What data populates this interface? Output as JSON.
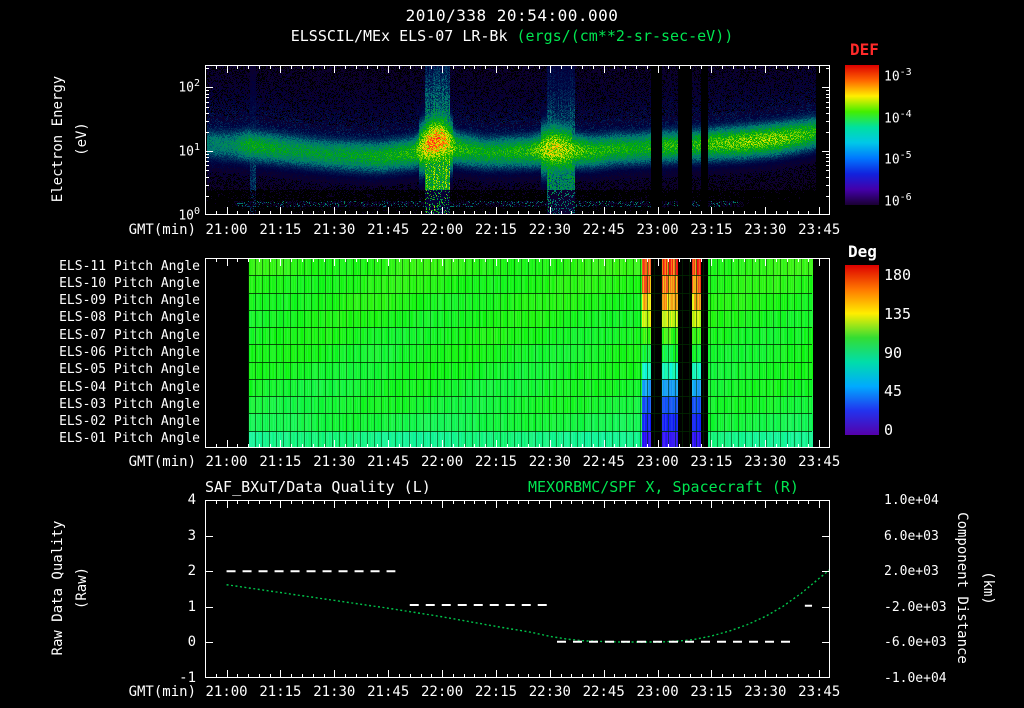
{
  "header": {
    "timestamp": "2010/338 20:54:00.000",
    "instrument": "ELSSCIL/MEx ELS-07 LR-Bk",
    "units": "(ergs/(cm**2-sr-sec-eV))"
  },
  "colors": {
    "background": "#000000",
    "frame": "#ffffff",
    "text": "#ffffff",
    "green_text": "#00e550",
    "def_label": "#ff2a2a",
    "curve_green": "#00c24a",
    "quality_white": "#ffffff",
    "def_colorbar_stops": [
      "#dd0000",
      "#ff6600",
      "#ffee00",
      "#44ee00",
      "#00e0a0",
      "#00c8e8",
      "#0077ff",
      "#1122dd",
      "#4400aa",
      "#1a0033"
    ],
    "deg_colorbar_stops": [
      "#dd0000",
      "#ff7700",
      "#ffee00",
      "#33dd33",
      "#00ddaa",
      "#00aaff",
      "#2233ee",
      "#5500aa"
    ]
  },
  "time_axis": {
    "label": "GMT(min)",
    "start": "20:54",
    "end": "23:48",
    "total_minutes": 174,
    "major_ticks": [
      "21:00",
      "21:15",
      "21:30",
      "21:45",
      "22:00",
      "22:15",
      "22:30",
      "22:45",
      "23:00",
      "23:15",
      "23:30",
      "23:45"
    ],
    "major_tick_minutes": [
      6,
      21,
      36,
      51,
      66,
      81,
      96,
      111,
      126,
      141,
      156,
      171
    ]
  },
  "spectrogram_panel": {
    "ylabel_lines": [
      "Electron Energy",
      "(eV)"
    ],
    "y_ticks": [
      "10^2",
      "10^1",
      "10^0"
    ],
    "y_tick_log": [
      2,
      1,
      0
    ],
    "colorbar": {
      "label": "DEF",
      "ticks": [
        "10^-3",
        "10^-4",
        "10^-5",
        "10^-6"
      ]
    }
  },
  "pitch_panel": {
    "row_labels": [
      "ELS-11 Pitch Angle",
      "ELS-10 Pitch Angle",
      "ELS-09 Pitch Angle",
      "ELS-08 Pitch Angle",
      "ELS-07 Pitch Angle",
      "ELS-06 Pitch Angle",
      "ELS-05 Pitch Angle",
      "ELS-04 Pitch Angle",
      "ELS-03 Pitch Angle",
      "ELS-02 Pitch Angle",
      "ELS-01 Pitch Angle"
    ],
    "colorbar": {
      "label": "Deg",
      "ticks": [
        "180",
        "135",
        "90",
        "45",
        "0"
      ]
    }
  },
  "quality_panel": {
    "title_left": "SAF_BXuT/Data Quality (L)",
    "title_right": "MEXORBMC/SPF X, Spacecraft (R)",
    "ylabel_left_lines": [
      "Raw Data Quality",
      "(Raw)"
    ],
    "ylabel_right_lines": [
      "Component Distance",
      "(km)"
    ],
    "y_ticks_left": [
      "4",
      "3",
      "2",
      "1",
      "0",
      "-1"
    ],
    "y_ticks_left_values": [
      4,
      3,
      2,
      1,
      0,
      -1
    ],
    "y_ticks_right": [
      "1.0e+04",
      "6.0e+03",
      "2.0e+03",
      "-2.0e+03",
      "-6.0e+03",
      "-1.0e+04"
    ]
  },
  "chart_data": [
    {
      "type": "heatmap",
      "title": "ELSSCIL/MEx ELS-07 LR-Bk electron energy spectrogram",
      "units": "ergs/(cm**2-sr-sec-eV)",
      "xlabel": "GMT(min)",
      "ylabel": "Electron Energy (eV)",
      "x_range": [
        "20:54",
        "23:48"
      ],
      "y_scale": "log",
      "y_range_eV": [
        1,
        200
      ],
      "colorbar_log10_range": [
        -6,
        -3
      ],
      "band_profile_t_logE_amp": [
        [
          0,
          1.12,
          0.38
        ],
        [
          8,
          1.1,
          0.42
        ],
        [
          12,
          1.1,
          0.55
        ],
        [
          24,
          1.02,
          0.5
        ],
        [
          36,
          0.95,
          0.5
        ],
        [
          48,
          0.92,
          0.55
        ],
        [
          58,
          0.98,
          0.6
        ],
        [
          63,
          1.15,
          0.95
        ],
        [
          66,
          1.18,
          0.9
        ],
        [
          70,
          1.05,
          0.62
        ],
        [
          78,
          0.98,
          0.55
        ],
        [
          90,
          1.0,
          0.6
        ],
        [
          97,
          1.05,
          0.8
        ],
        [
          102,
          1.02,
          0.7
        ],
        [
          108,
          1.0,
          0.6
        ],
        [
          114,
          1.04,
          0.58
        ],
        [
          120,
          1.05,
          0.55
        ],
        [
          128,
          1.08,
          0.6
        ],
        [
          136,
          1.1,
          0.6
        ],
        [
          142,
          1.12,
          0.65
        ],
        [
          150,
          1.15,
          0.7
        ],
        [
          159,
          1.2,
          0.7
        ],
        [
          165,
          1.25,
          0.65
        ],
        [
          170,
          1.3,
          0.6
        ]
      ],
      "bright_events": [
        {
          "t": [
            12.5,
            14
          ],
          "strength": 0.33
        },
        {
          "t": [
            61,
            68
          ],
          "strength": 0.85
        },
        {
          "t": [
            95,
            103
          ],
          "strength": 0.6
        }
      ],
      "data_gaps_min": [
        [
          124,
          127
        ],
        [
          131.5,
          135.5
        ],
        [
          138,
          140
        ]
      ],
      "data_range_min": [
        0.5,
        170
      ]
    },
    {
      "type": "heatmap",
      "title": "ELS anode pitch angles",
      "units": "degrees",
      "rows": [
        "ELS-11",
        "ELS-10",
        "ELS-09",
        "ELS-08",
        "ELS-07",
        "ELS-06",
        "ELS-05",
        "ELS-04",
        "ELS-03",
        "ELS-02",
        "ELS-01"
      ],
      "colorbar_range_deg": [
        0,
        180
      ],
      "baseline_deg_per_row": [
        104,
        102,
        101,
        100,
        99,
        98,
        97,
        96,
        95,
        92,
        80
      ],
      "data_range_min": [
        12,
        169
      ],
      "data_gaps_min": [
        [
          124,
          127
        ],
        [
          131.5,
          135.5
        ],
        [
          138,
          140
        ]
      ],
      "anomalies_min": [
        [
          121.5,
          124
        ],
        [
          127,
          131.5
        ],
        [
          135.5,
          138
        ]
      ],
      "anomaly_deg_per_row": [
        168,
        160,
        148,
        132,
        108,
        92,
        70,
        46,
        32,
        24,
        16
      ]
    },
    {
      "type": "line",
      "title_left": "SAF_BXuT/Data Quality (L)",
      "title_right": "MEXORBMC/SPF X, Spacecraft (R)",
      "xlabel": "GMT(min)",
      "left_axis": {
        "label": "Raw Data Quality (Raw)",
        "range": [
          -1,
          4
        ]
      },
      "right_axis": {
        "label": "Component Distance (km)",
        "range": [
          -10000,
          10000
        ]
      },
      "km_conversion": "km = -6000 + left_value*4000",
      "quality_segments": [
        {
          "value": 2.0,
          "t": [
            6,
            53
          ]
        },
        {
          "value": 1.05,
          "t": [
            57,
            96
          ]
        },
        {
          "value": 0.02,
          "t": [
            98,
            164
          ]
        },
        {
          "value": 1.03,
          "t": [
            167,
            169
          ]
        }
      ],
      "spacecraft_x_points_t_v": [
        [
          6,
          1.62
        ],
        [
          21,
          1.4
        ],
        [
          36,
          1.18
        ],
        [
          51,
          0.96
        ],
        [
          66,
          0.72
        ],
        [
          81,
          0.45
        ],
        [
          91,
          0.28
        ],
        [
          96,
          0.17
        ],
        [
          101,
          0.09
        ],
        [
          106,
          0.04
        ],
        [
          116,
          0.01
        ],
        [
          126,
          0.01
        ],
        [
          131,
          0.03
        ],
        [
          136,
          0.08
        ],
        [
          141,
          0.18
        ],
        [
          146,
          0.32
        ],
        [
          151,
          0.5
        ],
        [
          156,
          0.73
        ],
        [
          161,
          1.02
        ],
        [
          166,
          1.38
        ],
        [
          171,
          1.8
        ],
        [
          174,
          2.05
        ]
      ]
    }
  ]
}
